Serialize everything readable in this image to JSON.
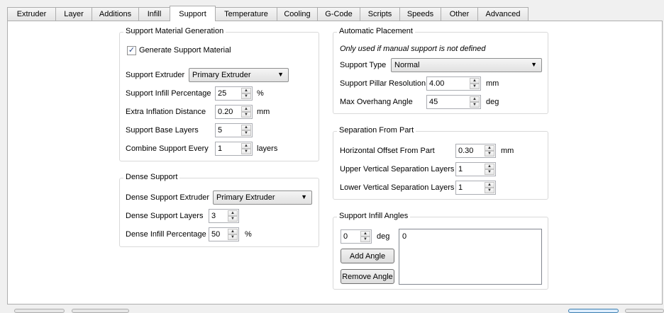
{
  "tabs": [
    {
      "label": "Extruder"
    },
    {
      "label": "Layer"
    },
    {
      "label": "Additions"
    },
    {
      "label": "Infill"
    },
    {
      "label": "Support",
      "active": true
    },
    {
      "label": "Temperature"
    },
    {
      "label": "Cooling"
    },
    {
      "label": "G-Code"
    },
    {
      "label": "Scripts"
    },
    {
      "label": "Speeds"
    },
    {
      "label": "Other"
    },
    {
      "label": "Advanced"
    }
  ],
  "support_material_generation": {
    "title": "Support Material Generation",
    "generate_label": "Generate Support Material",
    "generate_checked": true,
    "extruder_label": "Support Extruder",
    "extruder_value": "Primary Extruder",
    "infill_pct_label": "Support Infill Percentage",
    "infill_pct_value": "25",
    "infill_pct_unit": "%",
    "inflation_label": "Extra Inflation Distance",
    "inflation_value": "0.20",
    "inflation_unit": "mm",
    "base_layers_label": "Support Base Layers",
    "base_layers_value": "5",
    "combine_label": "Combine Support Every",
    "combine_value": "1",
    "combine_unit": "layers"
  },
  "dense_support": {
    "title": "Dense Support",
    "extruder_label": "Dense Support Extruder",
    "extruder_value": "Primary Extruder",
    "layers_label": "Dense Support Layers",
    "layers_value": "3",
    "infill_label": "Dense Infill Percentage",
    "infill_value": "50",
    "infill_unit": "%"
  },
  "automatic_placement": {
    "title": "Automatic Placement",
    "note": "Only used if manual support is not defined",
    "type_label": "Support Type",
    "type_value": "Normal",
    "pillar_label": "Support Pillar Resolution",
    "pillar_value": "4.00",
    "pillar_unit": "mm",
    "overhang_label": "Max Overhang Angle",
    "overhang_value": "45",
    "overhang_unit": "deg"
  },
  "separation": {
    "title": "Separation From Part",
    "horizontal_label": "Horizontal Offset From Part",
    "horizontal_value": "0.30",
    "horizontal_unit": "mm",
    "upper_label": "Upper Vertical Separation Layers",
    "upper_value": "1",
    "lower_label": "Lower Vertical Separation Layers",
    "lower_value": "1"
  },
  "infill_angles": {
    "title": "Support Infill Angles",
    "angle_value": "0",
    "angle_unit": "deg",
    "add_label": "Add Angle",
    "remove_label": "Remove Angle",
    "list_items": [
      "0"
    ]
  }
}
